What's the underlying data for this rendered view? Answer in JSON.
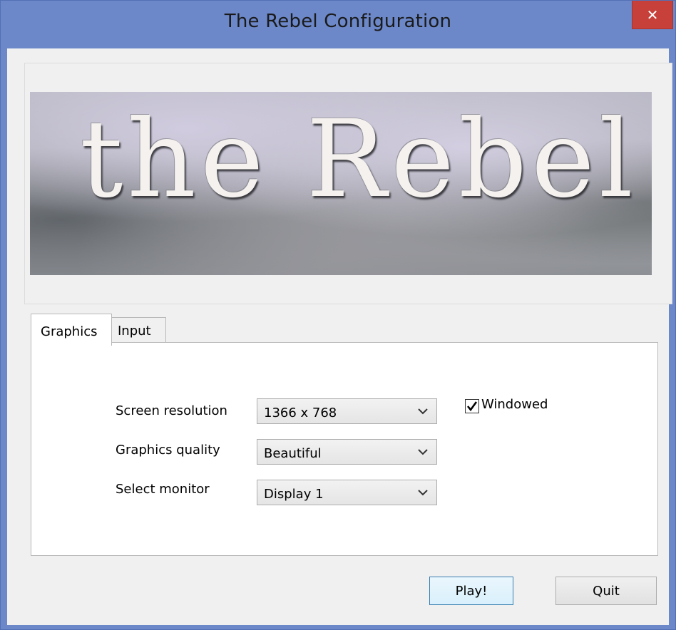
{
  "window": {
    "title": "The Rebel Configuration",
    "close_glyph": "✕",
    "accent_color": "#6c88c9",
    "close_color": "#c7413a"
  },
  "banner": {
    "logo_text": "the Rebel"
  },
  "tabs": [
    {
      "label": "Graphics",
      "selected": true
    },
    {
      "label": "Input",
      "selected": false
    }
  ],
  "graphics": {
    "resolution": {
      "label": "Screen resolution",
      "value": "1366 x 768"
    },
    "quality": {
      "label": "Graphics quality",
      "value": "Beautiful"
    },
    "monitor": {
      "label": "Select monitor",
      "value": "Display 1"
    },
    "windowed": {
      "label": "Windowed",
      "checked": true
    }
  },
  "buttons": {
    "play": "Play!",
    "quit": "Quit"
  },
  "icons": {
    "close": "close-icon",
    "dropdown": "chevron-down-icon",
    "check": "checkmark-icon"
  }
}
